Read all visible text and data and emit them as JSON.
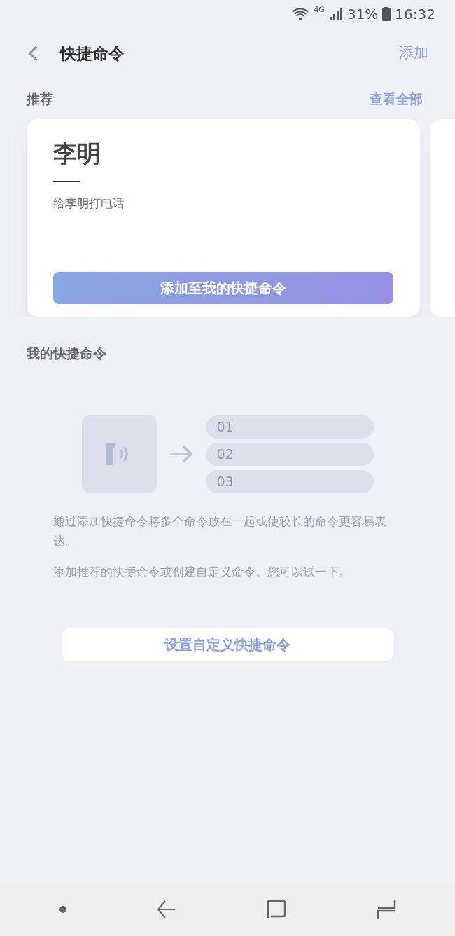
{
  "status_bar": {
    "network": "4G",
    "battery": "31%",
    "time": "16:32"
  },
  "header": {
    "title": "快捷命令",
    "action": "添加"
  },
  "recommended": {
    "label": "推荐",
    "view_all": "查看全部",
    "card": {
      "title": "李明",
      "subtitle": "给**李明**打电话",
      "button": "添加至我的快捷命令"
    }
  },
  "my_shortcuts": {
    "label": "我的快捷命令",
    "steps": [
      "01",
      "02",
      "03"
    ],
    "description": [
      "通过添加快捷命令将多个命令放在一起或使较长的命令更容易表达。",
      "添加推荐的快捷命令或创建自定义命令。您可以试一下。"
    ],
    "button": "设置自定义快捷命令"
  }
}
